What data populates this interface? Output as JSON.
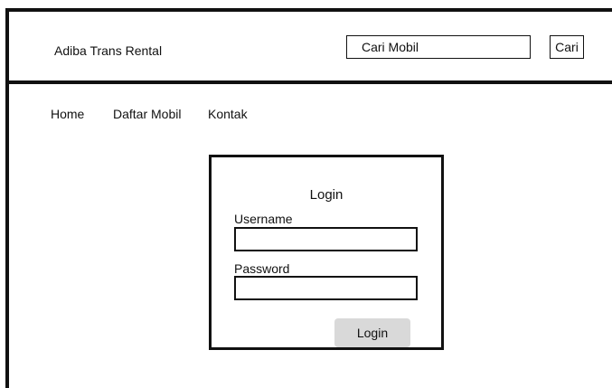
{
  "header": {
    "brand": "Adiba Trans Rental",
    "search": {
      "placeholder": "Cari Mobil",
      "value": ""
    },
    "search_button_label": "Cari"
  },
  "nav": {
    "items": [
      {
        "label": "Home"
      },
      {
        "label": "Daftar Mobil"
      },
      {
        "label": "Kontak"
      }
    ]
  },
  "login": {
    "title": "Login",
    "username_label": "Username",
    "username_value": "",
    "password_label": "Password",
    "password_value": "",
    "submit_label": "Login"
  }
}
